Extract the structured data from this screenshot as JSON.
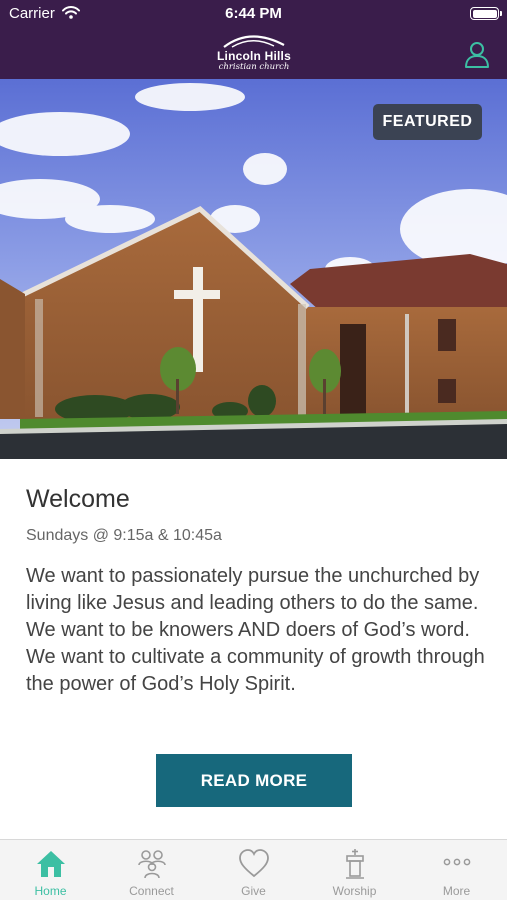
{
  "status_bar": {
    "carrier": "Carrier",
    "time": "6:44 PM"
  },
  "header": {
    "logo_name": "Lincoln Hills",
    "logo_subtitle": "christian church",
    "profile_icon": "user-outline-icon",
    "background_color": "#3a1d4b",
    "icon_color": "#3cbfa3"
  },
  "hero": {
    "badge": "FEATURED"
  },
  "content": {
    "title": "Welcome",
    "schedule": "Sundays @ 9:15a & 10:45a",
    "body": "We want to passionately pursue the unchurched by living like Jesus and leading others to do the same. We want to be knowers AND doers of God’s word. We want to cultivate a community of growth through the power of God’s Holy Spirit.",
    "button_label": "READ MORE",
    "button_color": "#17687c"
  },
  "tab_bar": {
    "active_color": "#3cbfa3",
    "tabs": [
      {
        "label": "Home",
        "icon": "house-icon",
        "active": true
      },
      {
        "label": "Connect",
        "icon": "people-icon",
        "active": false
      },
      {
        "label": "Give",
        "icon": "heart-icon",
        "active": false
      },
      {
        "label": "Worship",
        "icon": "podium-icon",
        "active": false
      },
      {
        "label": "More",
        "icon": "ellipsis-icon",
        "active": false
      }
    ]
  }
}
